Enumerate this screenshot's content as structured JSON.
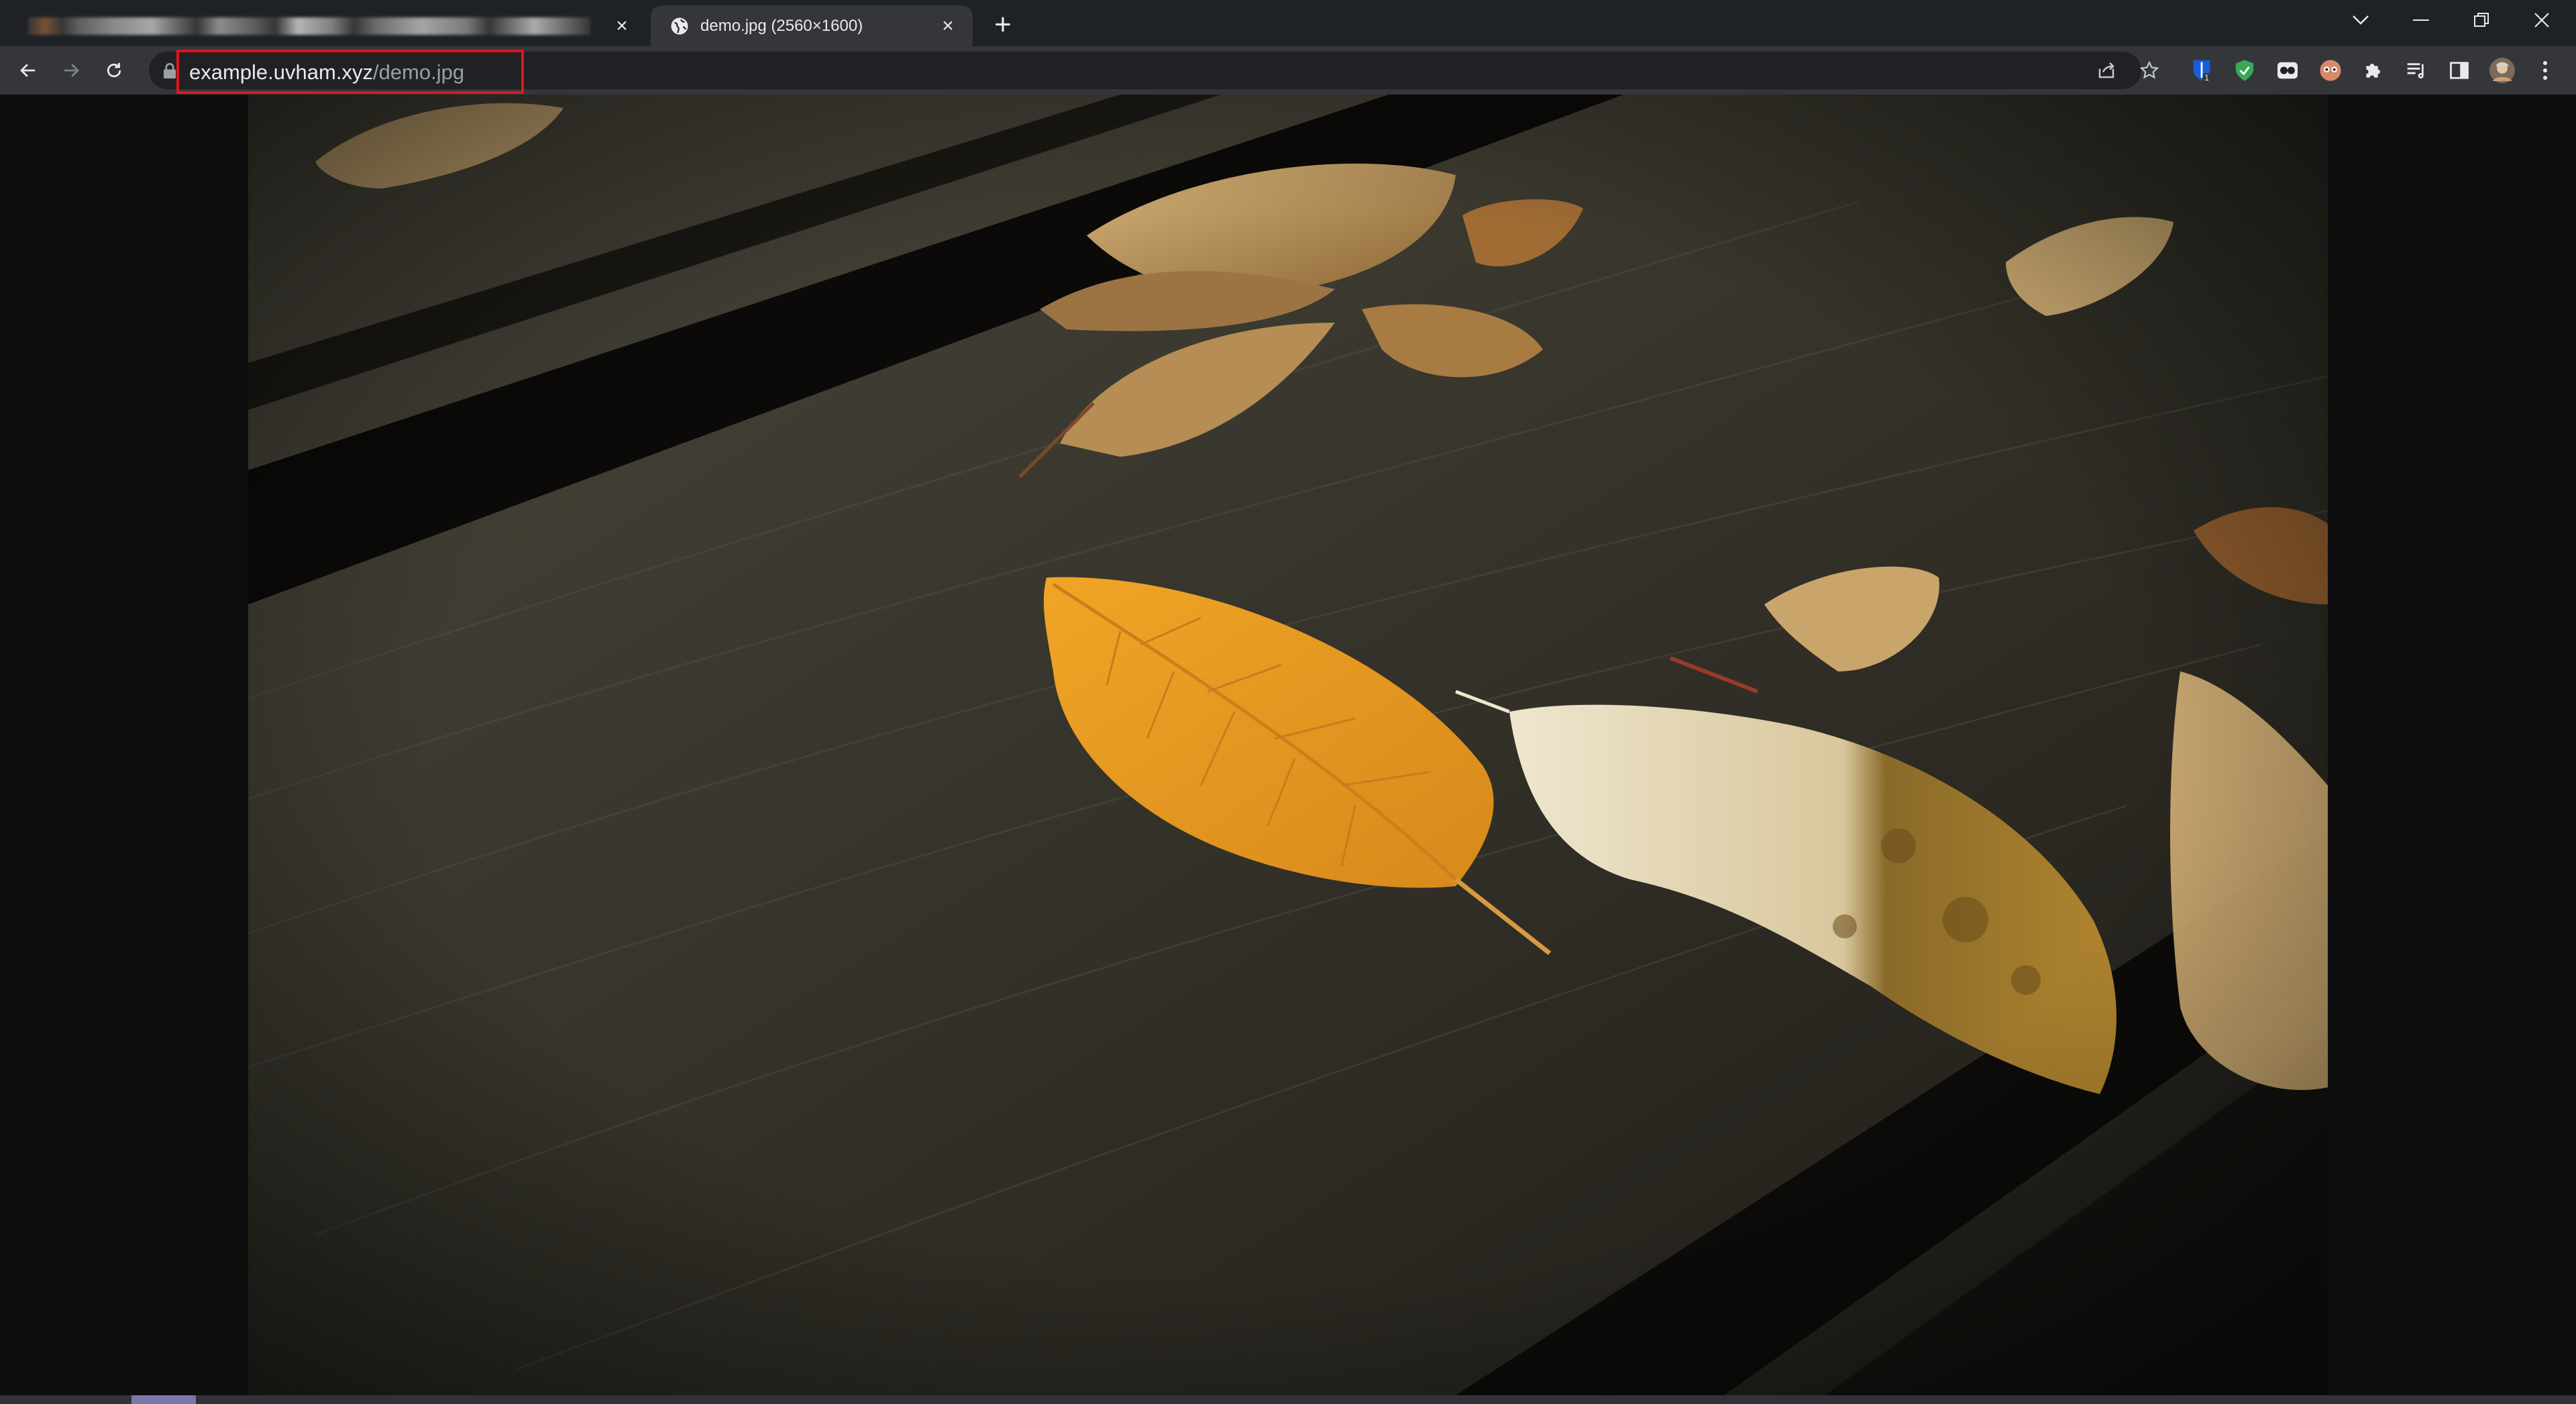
{
  "browser": {
    "tabs": [
      {
        "title": "",
        "active": false,
        "blurred": true
      },
      {
        "title": "demo.jpg (2560×1600)",
        "active": true,
        "icon": "globe-icon"
      }
    ],
    "new_tab_symbol": "+",
    "close_symbol": "×",
    "window_controls": [
      "tab-search-icon",
      "minimize-icon",
      "restore-icon",
      "close-icon"
    ]
  },
  "toolbar": {
    "url_host": "example.uvham.xyz",
    "url_path": "/demo.jpg",
    "annotation_color": "#e0161a",
    "icons": [
      "share-icon",
      "star-icon",
      "bitwarden-icon",
      "shield-extension-icon",
      "eyes-extension-icon",
      "face-extension-icon",
      "puzzle-icon",
      "reading-list-icon",
      "side-panel-icon",
      "profile-avatar",
      "menu-icon"
    ]
  },
  "content": {
    "image_alt": "demo.jpg",
    "image_description_colors": {
      "wood": "#2c2a22",
      "leaf": "#e39a1c",
      "background": "#0e0e0e"
    }
  }
}
